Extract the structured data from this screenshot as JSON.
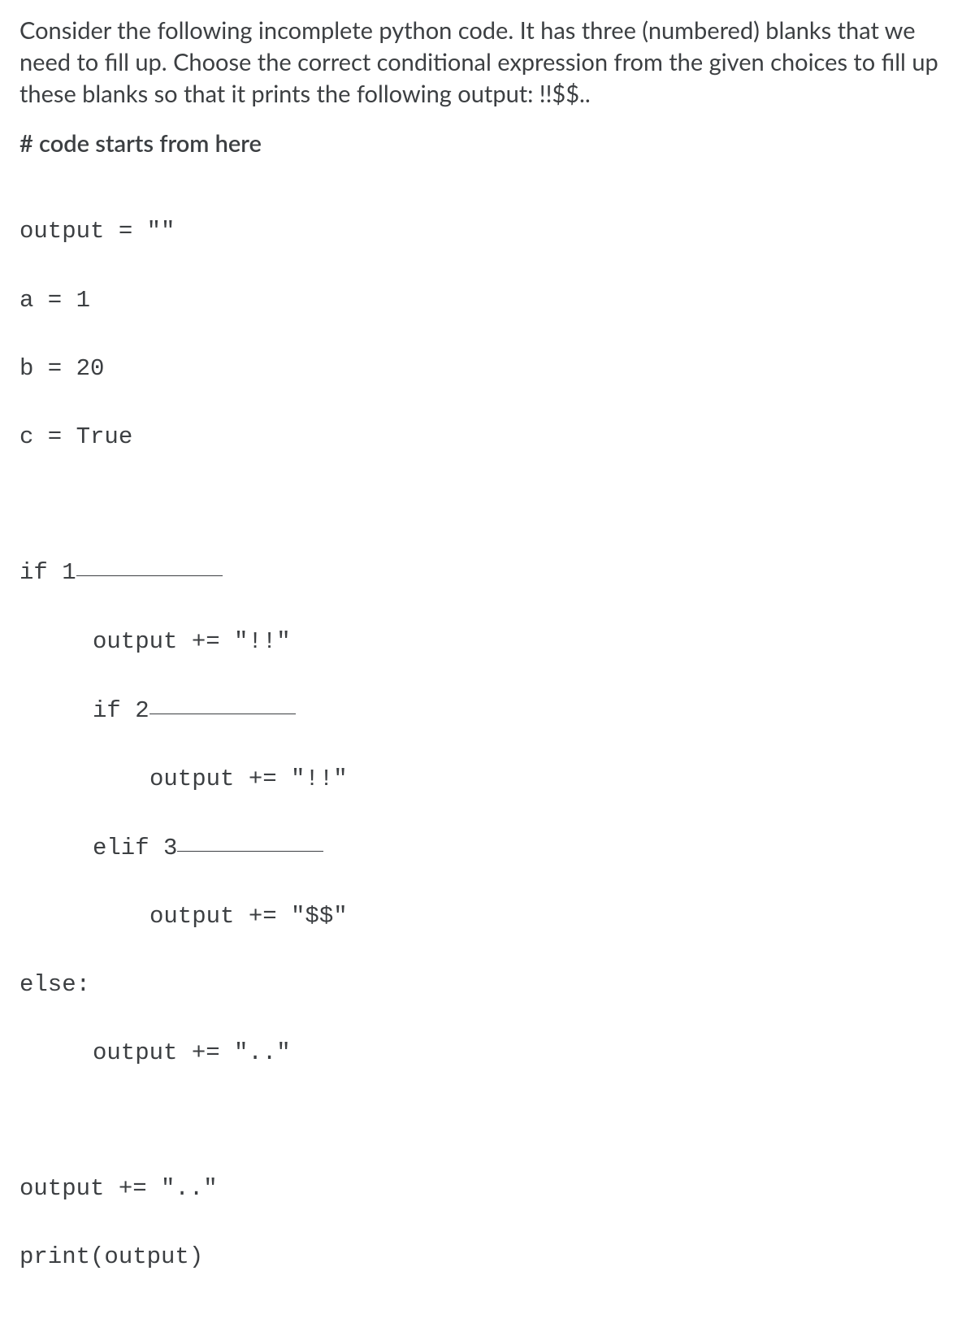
{
  "question": {
    "paragraph": "Consider the following incomplete python code. It has three (numbered) blanks that we need to fill up. Choose the correct conditional expression from the given choices to fill up these blanks so that it prints the following output: !!$$.."
  },
  "comment": "# code starts from here",
  "code": {
    "l1": "output = \"\"",
    "l2": "a = 1",
    "l3": "b = 20",
    "l4": "c = True",
    "l5a": "if 1",
    "l6": "output += \"!!\"",
    "l7a": "if 2",
    "l8": "output += \"!!\"",
    "l9a": "elif 3",
    "l10": "output += \"$$\"",
    "l11": "else:",
    "l12": "output += \"..\"",
    "l13": "output += \"..\"",
    "l14": "print(output)"
  }
}
